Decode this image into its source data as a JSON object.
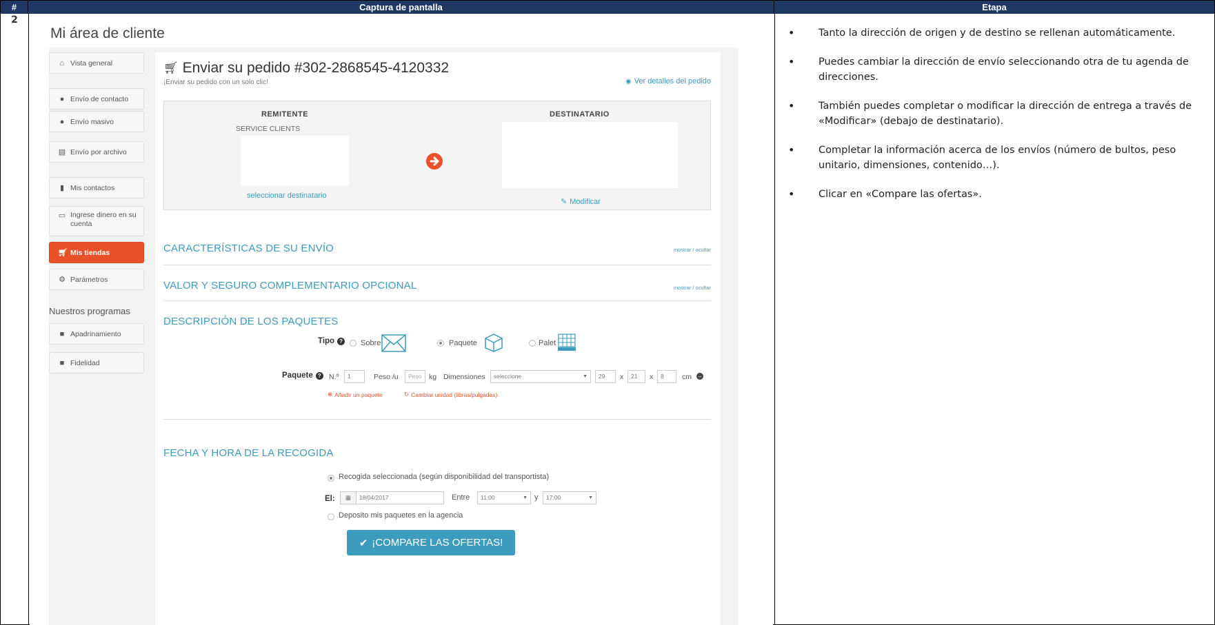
{
  "header": {
    "num": "#",
    "captura": "Captura de pantalla",
    "etapa": "Etapa"
  },
  "row_number": "2",
  "steps": [
    "Tanto la dirección de origen y de destino se rellenan automáticamente.",
    "Puedes cambiar la dirección de envío seleccionando otra de tu agenda de direcciones.",
    "También puedes completar o modificar la dirección de entrega a través de «Modificar» (debajo de destinatario).",
    "Completar la información acerca de los envíos (número de bultos, peso unitario, dimensiones, contenido…).",
    "Clicar en «Compare las ofertas»."
  ],
  "page": {
    "title": "Mi área de cliente"
  },
  "sidebar": {
    "items": [
      {
        "label": "Vista general",
        "icon": "home-icon"
      },
      {
        "label": "Envío de contacto",
        "icon": "user-icon"
      },
      {
        "label": "Envío masivo",
        "icon": "users-icon"
      },
      {
        "label": "Envío por archivo",
        "icon": "file-icon"
      },
      {
        "label": "Mis contactos",
        "icon": "book-icon"
      },
      {
        "label": "Ingrese dinero en su cuenta",
        "icon": "card-icon"
      },
      {
        "label": "Mis tiendas",
        "icon": "cart-icon"
      },
      {
        "label": "Parámetros",
        "icon": "gears-icon"
      }
    ],
    "programs_heading": "Nuestros programas",
    "programs": [
      {
        "label": "Apadrinamiento",
        "icon": "gift-icon"
      },
      {
        "label": "Fidelidad",
        "icon": "gift-icon"
      }
    ]
  },
  "order": {
    "title": "Enviar su pedido #302-2868545-4120332",
    "subtitle": "¡Enviar su pedido con un solo clic!",
    "details_link": "Ver detalles del pedido",
    "sender_heading": "REMITENTE",
    "sender_name": "SERVICE CLIENTS",
    "select_recipient": "seleccionar destinatario",
    "recipient_heading": "DESTINATARIO",
    "modify_link": "Modificar"
  },
  "sections": {
    "features": "CARACTERÍSTICAS DE SU ENVÍO",
    "insurance": "VALOR Y SEGURO COMPLEMENTARIO OPCIONAL",
    "toggle": "mostrar / ocultar",
    "packages": "DESCRIPCIÓN DE LOS PAQUETES",
    "pickup": "FECHA Y HORA DE LA RECOGIDA"
  },
  "package_form": {
    "type_label": "Tipo",
    "types": [
      "Sobre",
      "Paquete",
      "Palet"
    ],
    "selected_type": "Paquete",
    "package_label": "Paquete",
    "n_label": "N.º",
    "n_value": "1",
    "weight_label": "Peso /u",
    "weight_placeholder": "Peso",
    "weight_unit": "kg",
    "dims_label": "Dimensiones",
    "dims_select": "seleccione",
    "len": "29",
    "wid": "21",
    "hei": "8",
    "x1": "x",
    "x2": "x",
    "dim_unit": "cm",
    "add_package": "Añadir un paquete",
    "change_unit": "Cambiar unidad (libras/pulgadas)"
  },
  "pickup_form": {
    "option_selected": "Recogida seleccionada (según disponibilidad del transportista)",
    "date_label": "El:",
    "date_value": "18/04/2017",
    "between_label": "Entre",
    "from_time": "11:00",
    "and_label": "y",
    "to_time": "17:00",
    "option_agency": "Deposito mis paquetes en la agencia"
  },
  "compare_button": "¡COMPARE LAS OFERTAS!",
  "colors": {
    "header_bg": "#1f3864",
    "accent_blue": "#3d9bbd",
    "accent_orange": "#e8512a"
  }
}
